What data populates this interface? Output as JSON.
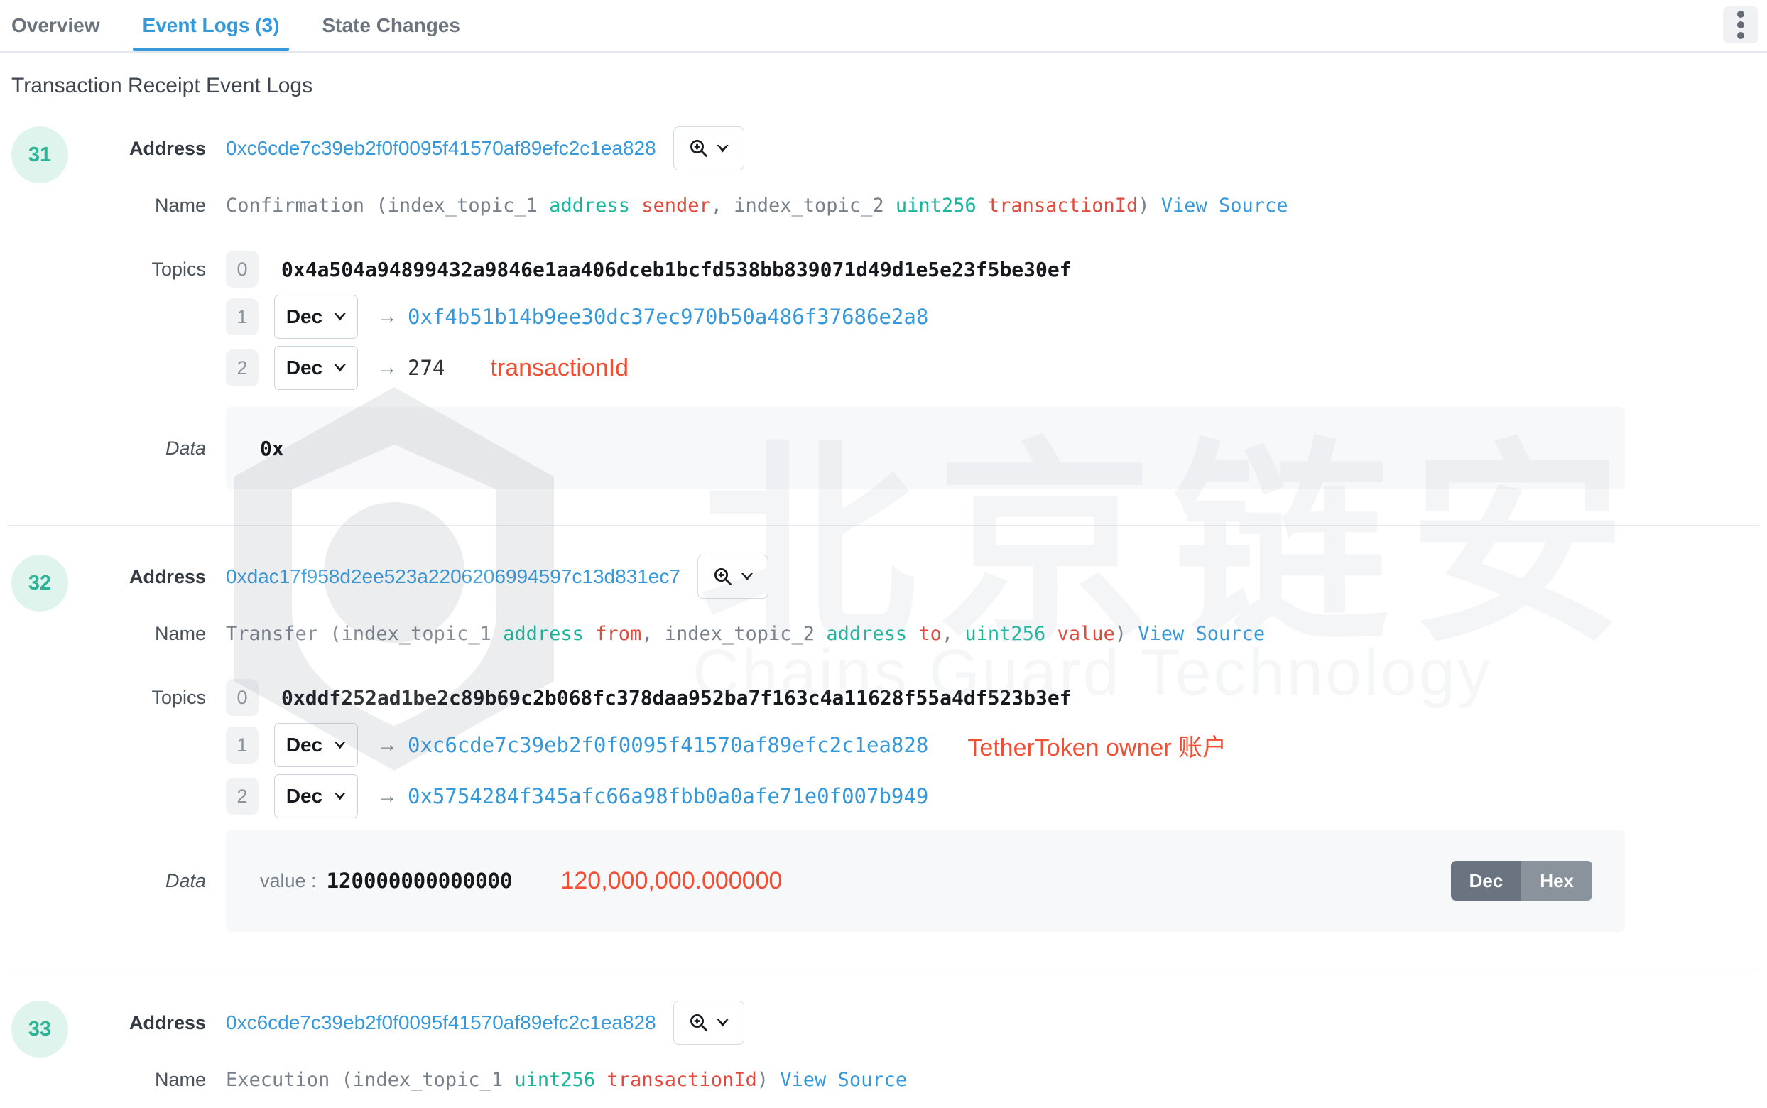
{
  "colors": {
    "accent_blue": "#3498db",
    "type_green": "#18b69b",
    "param_red": "#e2493d",
    "annotation_red": "#f34e32",
    "badge_green_text": "#2bb596",
    "badge_green_bg": "#dff4ec",
    "dec_button_dark": "#6a7480",
    "hex_button_light": "#8a929c"
  },
  "tabs": [
    {
      "label": "Overview"
    },
    {
      "label": "Event Logs (3)"
    },
    {
      "label": "State Changes"
    }
  ],
  "heading": "Transaction Receipt Event Logs",
  "row_labels": {
    "address": "Address",
    "name": "Name",
    "topics": "Topics",
    "data": "Data"
  },
  "topic_badges": [
    "0",
    "1",
    "2"
  ],
  "ui": {
    "arrow": "→",
    "view_source": "View Source",
    "dec_selector": "Dec",
    "data_value_label": "value :",
    "dec_button": "Dec",
    "hex_button": "Hex"
  },
  "logs": [
    {
      "badge": "31",
      "address": "0xc6cde7c39eb2f0f0095f41570af89efc2c1ea828",
      "name_segments": [
        "Confirmation (index_topic_1 ",
        "address",
        " sender",
        ", index_topic_2 ",
        "uint256",
        " transactionId",
        ") "
      ],
      "topic0_hash": "0x4a504a94899432a9846e1aa406dceb1bcfd538bb839071d49d1e5e23f5be30ef",
      "topic1_value": "0xf4b51b14b9ee30dc37ec970b50a486f37686e2a8",
      "topic2_value": "274",
      "topic2_annotation": "transactionId",
      "data_content": "0x"
    },
    {
      "badge": "32",
      "address": "0xdac17f958d2ee523a2206206994597c13d831ec7",
      "name_segments": [
        "Transfer (index_topic_1 ",
        "address",
        " from",
        ", index_topic_2 ",
        "address",
        " to",
        ", ",
        "uint256",
        " value",
        ") "
      ],
      "topic0_hash": "0xddf252ad1be2c89b69c2b068fc378daa952ba7f163c4a11628f55a4df523b3ef",
      "topic1_value": "0xc6cde7c39eb2f0f0095f41570af89efc2c1ea828",
      "topic1_annotation": "TetherToken owner 账户",
      "topic2_value": "0x5754284f345afc66a98fbb0a0afe71e0f007b949",
      "data_value": "120000000000000",
      "data_annotation": "120,000,000.000000"
    },
    {
      "badge": "33",
      "address": "0xc6cde7c39eb2f0f0095f41570af89efc2c1ea828",
      "name_segments": [
        "Execution (index_topic_1 ",
        "uint256",
        " transactionId",
        ") "
      ]
    }
  ],
  "watermark": {
    "cn": "北京链安",
    "en": "Chains Guard Technology"
  }
}
